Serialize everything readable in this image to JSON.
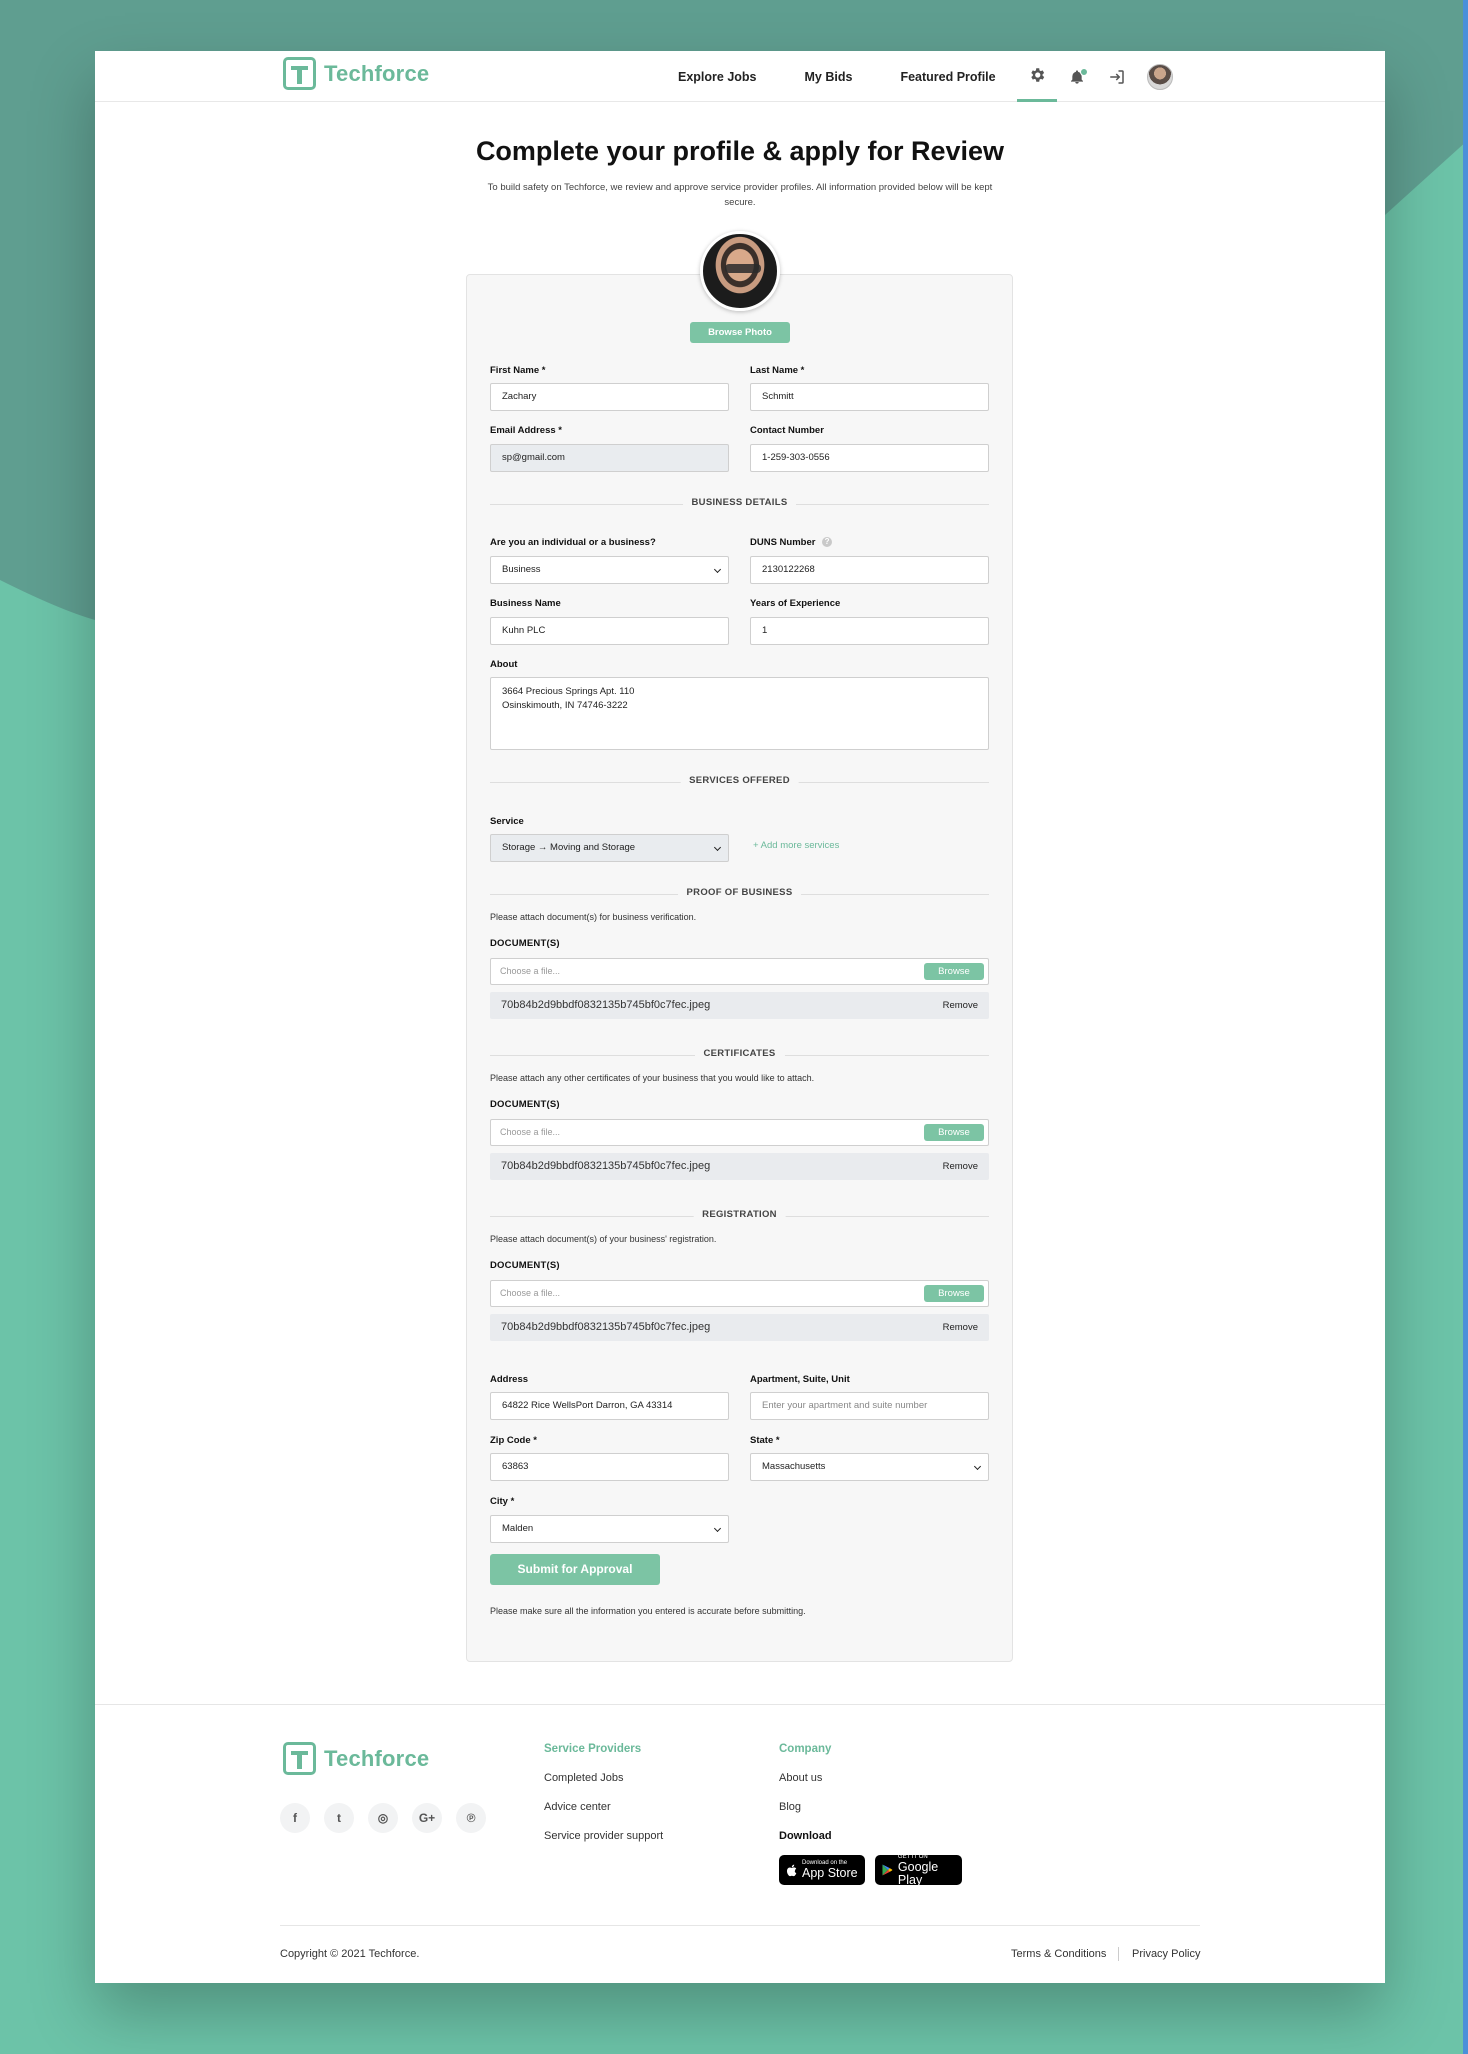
{
  "brand": {
    "name": "Techforce",
    "accent": "#6bb99a",
    "background": "#5f9e90"
  },
  "nav": {
    "links": [
      "Explore Jobs",
      "My Bids",
      "Featured Profile"
    ],
    "icons": [
      "gear-icon",
      "notification-bell-icon",
      "logout-icon",
      "avatar"
    ]
  },
  "header": {
    "title": "Complete your profile & apply for Review",
    "subtitle": "To build safety on Techforce, we review and approve service provider profiles. All information provided below will be kept secure."
  },
  "profile": {
    "browse_photo": "Browse Photo"
  },
  "form": {
    "first_name": {
      "label": "First Name *",
      "value": "Zachary"
    },
    "last_name": {
      "label": "Last Name *",
      "value": "Schmitt"
    },
    "email": {
      "label": "Email Address *",
      "value": "sp@gmail.com"
    },
    "contact": {
      "label": "Contact Number",
      "value": "1-259-303-0556"
    },
    "business_details": "BUSINESS DETAILS",
    "entity_type": {
      "label": "Are you an individual or a business?",
      "value": "Business"
    },
    "duns": {
      "label": "DUNS Number",
      "value": "2130122268"
    },
    "business_name": {
      "label": "Business Name",
      "value": "Kuhn PLC"
    },
    "years": {
      "label": "Years of Experience",
      "value": "1"
    },
    "about": {
      "label": "About",
      "value": "3664 Precious Springs Apt. 110\nOsinskimouth, IN 74746-3222"
    },
    "services_offered": "SERVICES OFFERED",
    "service": {
      "label": "Service",
      "value": "Storage → Moving and Storage",
      "add_more": "+ Add more services"
    },
    "proof": {
      "heading": "PROOF OF BUSINESS",
      "hint": "Please attach document(s) for business verification.",
      "doc_label": "DOCUMENT(S)",
      "placeholder": "Choose a file...",
      "browse": "Browse",
      "file": "70b84b2d9bbdf0832135b745bf0c7fec.jpeg",
      "remove": "Remove"
    },
    "certificates": {
      "heading": "CERTIFICATES",
      "hint": "Please attach any other certificates of your business that you would like to attach.",
      "doc_label": "DOCUMENT(S)",
      "placeholder": "Choose a file...",
      "browse": "Browse",
      "file": "70b84b2d9bbdf0832135b745bf0c7fec.jpeg",
      "remove": "Remove"
    },
    "registration": {
      "heading": "REGISTRATION",
      "hint": "Please attach document(s) of your business' registration.",
      "doc_label": "DOCUMENT(S)",
      "placeholder": "Choose a file...",
      "browse": "Browse",
      "file": "70b84b2d9bbdf0832135b745bf0c7fec.jpeg",
      "remove": "Remove"
    },
    "address": {
      "label": "Address",
      "value": "64822 Rice WellsPort Darron, GA 43314"
    },
    "apartment": {
      "label": "Apartment, Suite, Unit",
      "placeholder": "Enter your apartment and suite number"
    },
    "zip": {
      "label": "Zip Code *",
      "value": "63863"
    },
    "state": {
      "label": "State *",
      "value": "Massachusetts"
    },
    "city": {
      "label": "City *",
      "value": "Malden"
    },
    "submit": "Submit for Approval",
    "note": "Please make sure all the information you entered is accurate before submitting."
  },
  "footer": {
    "brand": "Techforce",
    "socials": [
      "f",
      "t",
      "◎",
      "G+",
      "℗"
    ],
    "service_providers": {
      "title": "Service Providers",
      "links": [
        "Completed Jobs",
        "Advice center",
        "Service provider support"
      ]
    },
    "company": {
      "title": "Company",
      "links": [
        "About us",
        "Blog"
      ]
    },
    "download": {
      "title": "Download",
      "app_store": {
        "small": "Download on the",
        "big": "App Store"
      },
      "google_play": {
        "small": "GET IT ON",
        "big": "Google Play"
      }
    },
    "copyright": "Copyright © 2021 Techforce.",
    "terms": "Terms & Conditions",
    "privacy": "Privacy Policy"
  }
}
